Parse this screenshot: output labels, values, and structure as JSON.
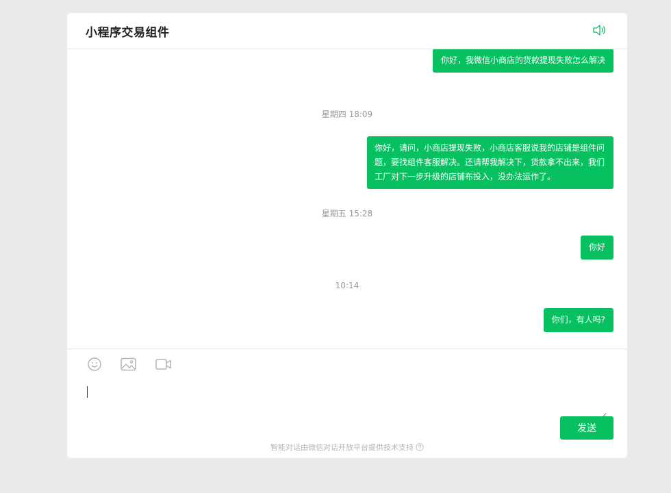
{
  "header": {
    "title": "小程序交易组件",
    "speaker_icon": "speaker-icon"
  },
  "messages": [
    {
      "type": "user",
      "text": "你好，我微信小商店的货款提现失败怎么解决"
    },
    {
      "type": "time",
      "text": "星期四 18:09"
    },
    {
      "type": "user",
      "lines": [
        "你好，请问，小商店提现失败，小商店客服说我的店铺是组件问",
        "题，要找组件客服解决。还请帮我解决下，货款拿不出来，我们",
        "工厂对下一步升级的店铺布投入，没办法运作了。"
      ]
    },
    {
      "type": "time",
      "text": "星期五 15:28"
    },
    {
      "type": "user",
      "text": "你好"
    },
    {
      "type": "time",
      "text": "10:14"
    },
    {
      "type": "user",
      "text": "你们，有人吗?"
    }
  ],
  "composer": {
    "tools": [
      "emoji-icon",
      "image-icon",
      "video-icon"
    ],
    "input_value": "",
    "send_label": "发送"
  },
  "footer": {
    "text": "智能对话由微信对话开放平台提供技术支持"
  },
  "colors": {
    "accent": "#07c160",
    "background": "#ebebeb",
    "panel": "#ffffff",
    "timestamp": "#999999"
  }
}
